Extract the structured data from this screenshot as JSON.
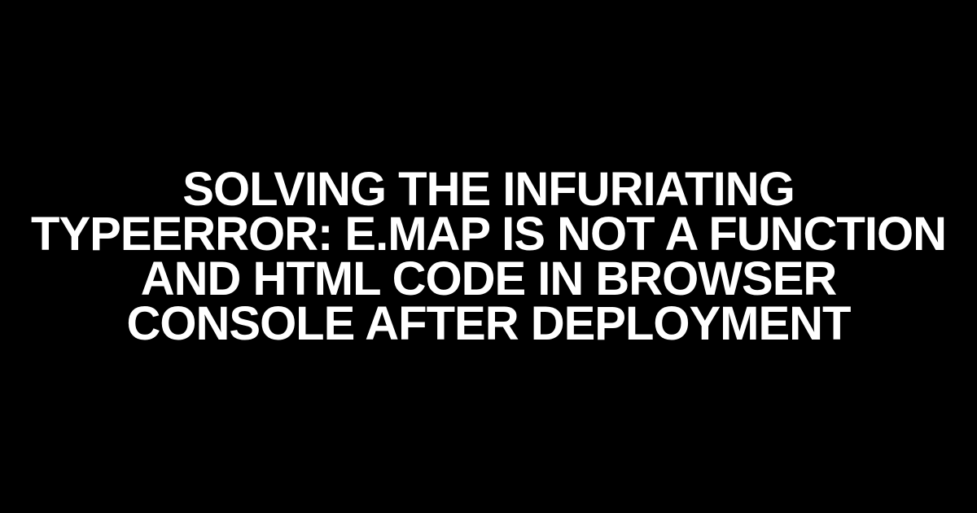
{
  "headline": "SOLVING THE INFURIATING TYPEERROR: E.MAP IS NOT A FUNCTION AND HTML CODE IN BROWSER CONSOLE AFTER DEPLOYMENT"
}
